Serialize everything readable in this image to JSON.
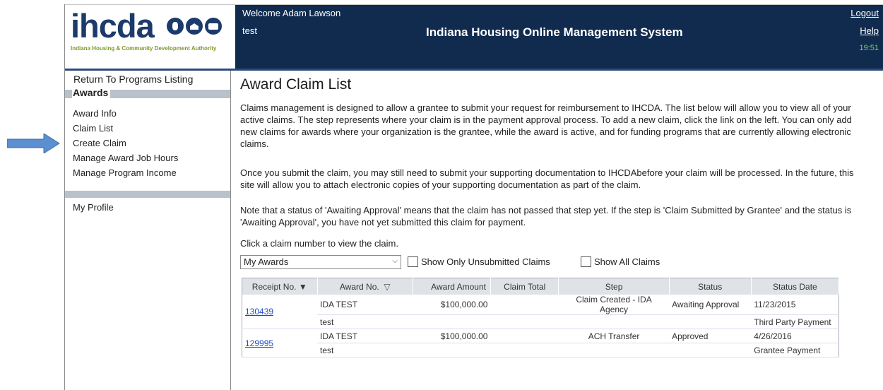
{
  "logo": {
    "wordmark": "ihcda",
    "subtitle": "Indiana Housing & Community Development Authority"
  },
  "header": {
    "welcome": "Welcome Adam Lawson",
    "user_sub": "test",
    "title": "Indiana Housing Online Management System",
    "logout": "Logout",
    "help": "Help",
    "clock": "19:51"
  },
  "sidebar": {
    "return_link": "Return To Programs Listing",
    "section": "Awards",
    "items": [
      {
        "label": "Award Info"
      },
      {
        "label": "Claim List"
      },
      {
        "label": "Create Claim"
      },
      {
        "label": "Manage Award Job Hours"
      },
      {
        "label": "Manage Program Income"
      }
    ],
    "profile": "My Profile"
  },
  "main": {
    "title": "Award Claim List",
    "para1": "Claims management is designed to allow a grantee to submit your request for reimbursement to IHCDA. The list below will allow you to view all of your active claims. The step represents where your claim is in the payment approval process. To add a new claim, click the link on the left. You can only add new claims for awards where your organization is the grantee, while the award is active, and for funding programs that are currently allowing electronic claims.",
    "para2": "Once you submit the claim, you may still need to submit your supporting documentation to IHCDAbefore your claim will be processed. In the future, this site will allow you to attach electronic copies of your supporting documentation as part of the claim.",
    "para3": "Note that a status of 'Awaiting Approval' means that the claim has not passed that step yet. If the step is 'Claim Submitted by Grantee' and the status is 'Awaiting Approval', you have not yet submitted this claim for payment.",
    "click_note": "Click a claim number to view the claim.",
    "filter_select": "My Awards",
    "check_unsubmitted": "Show Only Unsubmitted Claims",
    "check_all": "Show All Claims"
  },
  "table": {
    "headers": [
      "Receipt No.",
      "Award No.",
      "Award Amount",
      "Claim Total",
      "Step",
      "Status",
      "Status Date"
    ],
    "rows": [
      {
        "receipt": "130439",
        "award_no": "IDA TEST",
        "award_amount": "$100,000.00",
        "claim_total": "",
        "step": "Claim Created - IDA Agency",
        "status": "Awaiting Approval",
        "status_date": "11/23/2015",
        "sub_award": "test",
        "sub_type": "Third Party Payment"
      },
      {
        "receipt": "129995",
        "award_no": "IDA TEST",
        "award_amount": "$100,000.00",
        "claim_total": "",
        "step": "ACH Transfer",
        "status": "Approved",
        "status_date": "4/26/2016",
        "sub_award": "test",
        "sub_type": "Grantee Payment"
      }
    ]
  },
  "colors": {
    "header_bg": "#102b4e",
    "logo_blue": "#1c3a6b",
    "logo_green": "#7c9a2b",
    "clock_green": "#7cd26a",
    "arrow_blue": "#5b8fd0",
    "link_blue": "#1b4cc4"
  }
}
